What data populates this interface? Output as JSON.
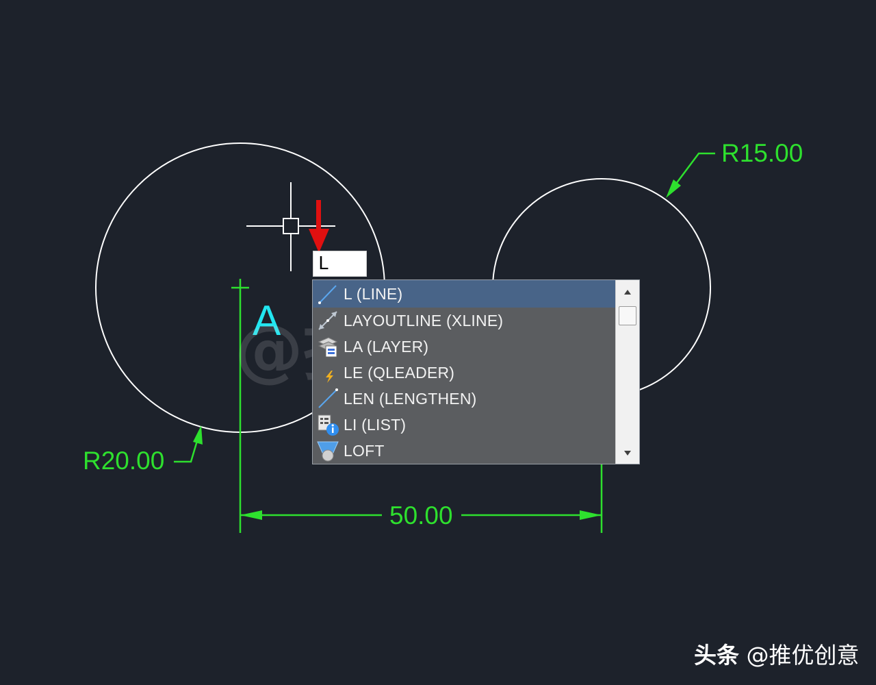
{
  "drawing": {
    "dimensions": {
      "radius_left": "R20.00",
      "radius_right": "R15.00",
      "linear": "50.00"
    },
    "point_label": "A",
    "watermark": "@推优创意"
  },
  "command_input": {
    "value": "L"
  },
  "autocomplete": {
    "items": [
      {
        "label": "L (LINE)",
        "icon": "line-icon",
        "selected": true
      },
      {
        "label": "LAYOUTLINE (XLINE)",
        "icon": "xline-icon"
      },
      {
        "label": "LA (LAYER)",
        "icon": "layer-icon"
      },
      {
        "label": "LE (QLEADER)",
        "icon": "qleader-icon"
      },
      {
        "label": "LEN (LENGTHEN)",
        "icon": "lengthen-icon"
      },
      {
        "label": "LI (LIST)",
        "icon": "list-icon"
      },
      {
        "label": "LOFT",
        "icon": "loft-icon"
      }
    ]
  },
  "watermark_corner": {
    "platform": "头条",
    "account": "@推优创意"
  },
  "colors": {
    "background": "#1d222b",
    "dimension": "#2ee02e",
    "circle": "#ffffff",
    "point_label": "#22e6f0",
    "arrow_annotation": "#e01010",
    "list_selected": "#486488",
    "list_background": "#5b5d60"
  }
}
